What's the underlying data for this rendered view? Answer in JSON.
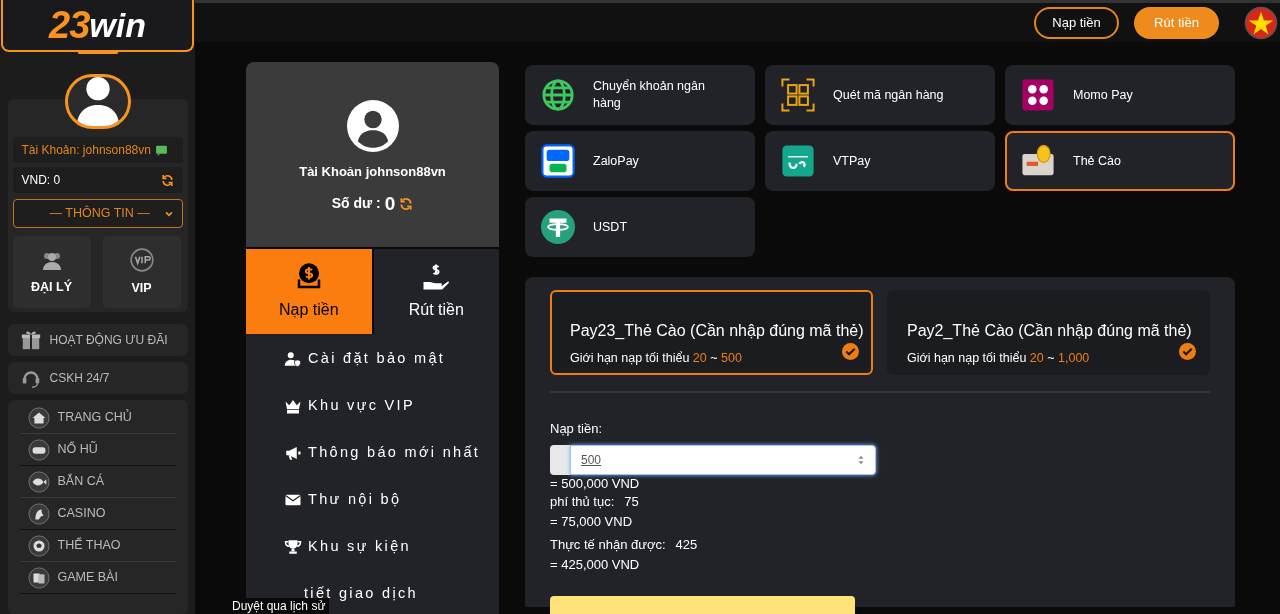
{
  "logo": {
    "digits": "23",
    "word": "win"
  },
  "header": {
    "buttons": [
      {
        "label": "Nạp tiền",
        "kind": "outline"
      },
      {
        "label": "Rút tiền",
        "kind": "filled"
      }
    ]
  },
  "sidebar": {
    "account": "Tài Khoản: johnson88vn",
    "balance": "VND: 0",
    "info_dropdown": "— THÔNG TIN —",
    "tiles": [
      {
        "label": "ĐẠI LÝ",
        "kind": "agent"
      },
      {
        "label": "VIP",
        "kind": "vip"
      }
    ],
    "links": [
      {
        "label": "HOẠT ĐỘNG ƯU ĐÃI",
        "kind": "gift"
      },
      {
        "label": "CSKH 24/7",
        "kind": "support"
      }
    ],
    "menu": [
      {
        "label": "TRANG CHỦ",
        "kind": "home"
      },
      {
        "label": "NỔ HŨ",
        "kind": "game"
      },
      {
        "label": "BẮN CÁ",
        "kind": "fish"
      },
      {
        "label": "CASINO",
        "kind": "casino"
      },
      {
        "label": "THỂ THAO",
        "kind": "ball"
      },
      {
        "label": "GAME BÀI",
        "kind": "cards"
      }
    ]
  },
  "profile": {
    "account": "Tài Khoản johnson88vn",
    "balance_label": "Số dư :",
    "balance": "0"
  },
  "tabs": [
    {
      "label": "Nạp tiền",
      "kind": "deposit",
      "selected": true
    },
    {
      "label": "Rút tiền",
      "kind": "withdraw",
      "selected": false
    }
  ],
  "account_menu": [
    {
      "label": "Cài đặt bảo mật",
      "kind": "security"
    },
    {
      "label": "Khu vực VIP",
      "kind": "vip"
    },
    {
      "label": "Thông báo mới nhất",
      "kind": "megaphone"
    },
    {
      "label": "Thư nội bộ",
      "kind": "mail"
    },
    {
      "label": "Khu sự kiện",
      "kind": "trophy"
    },
    {
      "label": "tiết giao dịch",
      "kind": "history"
    }
  ],
  "tooltip": "Duyệt qua lịch sử",
  "methods": [
    {
      "label": "Chuyển khoản ngân hàng",
      "kind": "bank",
      "selected": false
    },
    {
      "label": "Quét mã ngân hàng",
      "kind": "qr",
      "selected": false
    },
    {
      "label": "Momo Pay",
      "kind": "momo",
      "selected": false
    },
    {
      "label": "ZaloPay",
      "kind": "zalo",
      "selected": false
    },
    {
      "label": "VTPay",
      "kind": "vtpay",
      "selected": false
    },
    {
      "label": "Thẻ Cào",
      "kind": "card",
      "selected": true
    },
    {
      "label": "USDT",
      "kind": "usdt",
      "selected": false
    }
  ],
  "channels": [
    {
      "title": "Pay23_Thẻ Cào (Cần nhập đúng mã thẻ)",
      "limit_label": "Giới hạn nạp tối thiểu",
      "min": "20",
      "separator": "~",
      "max": "500",
      "selected": true
    },
    {
      "title": "Pay2_Thẻ Cào (Cần nhập đúng mã thẻ)",
      "limit_label": "Giới hạn nạp tối thiểu",
      "min": "20",
      "separator": "~",
      "max": "1,000",
      "selected": false
    }
  ],
  "form": {
    "label": "Nạp tiền:",
    "value": "500",
    "amount_vnd": "= 500,000 VND",
    "fee_label": "phí thủ tục:",
    "fee": "75",
    "fee_vnd": "= 75,000 VND",
    "received_label": "Thực tế nhận được:",
    "received": "425",
    "received_vnd": "= 425,000 VND"
  }
}
